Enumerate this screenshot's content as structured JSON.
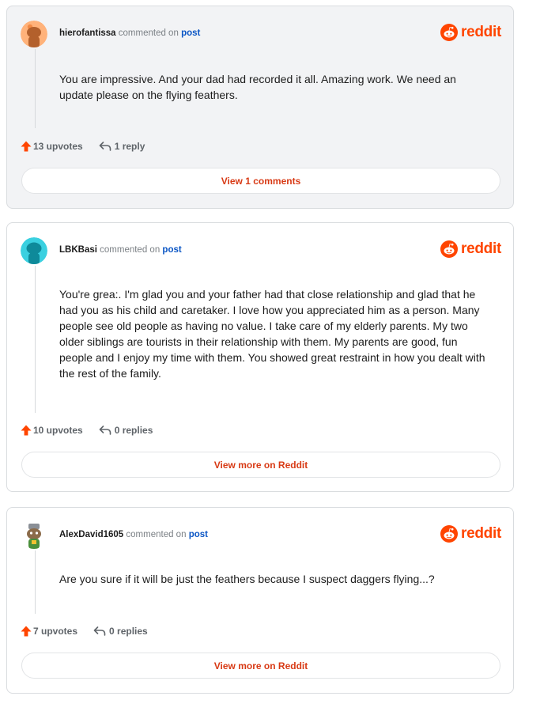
{
  "brand": {
    "word": "reddit",
    "color": "#ff4500"
  },
  "comments": [
    {
      "username": "hierofantissa",
      "action": "commented on",
      "target": "post",
      "text": "You are impressive. And your dad had recorded it all. Amazing work. We need an update please on the flying feathers.",
      "upvotes": "13 upvotes",
      "replies": "1 reply",
      "button": "View 1 comments",
      "avatar_icon": "orange-snoo-avatar"
    },
    {
      "username": "LBKBasi",
      "action": "commented on",
      "target": "post",
      "text": "You're grea:. I'm glad you and your father had that close relationship and glad that he had you as his child and caretaker. I love how you appreciated him as a person. Many people see old people as having no value. I take care of my elderly parents. My two older siblings are tourists in their relationship with them. My parents are good, fun people and I enjoy my time with them. You showed great restraint in how you dealt with the rest of the family.",
      "upvotes": "10 upvotes",
      "replies": "0 replies",
      "button": "View more on Reddit",
      "avatar_icon": "teal-snoo-avatar"
    },
    {
      "username": "AlexDavid1605",
      "action": "commented on",
      "target": "post",
      "text": "Are you sure if it will be just the feathers because I suspect daggers flying...?",
      "upvotes": "7 upvotes",
      "replies": "0 replies",
      "button": "View more on Reddit",
      "avatar_icon": "custom-snoo-avatar"
    }
  ],
  "colors": {
    "upvote": "#ff4500",
    "button_text": "#d83a15",
    "link": "#0b56c5",
    "card_highlight": "#f2f3f5"
  }
}
